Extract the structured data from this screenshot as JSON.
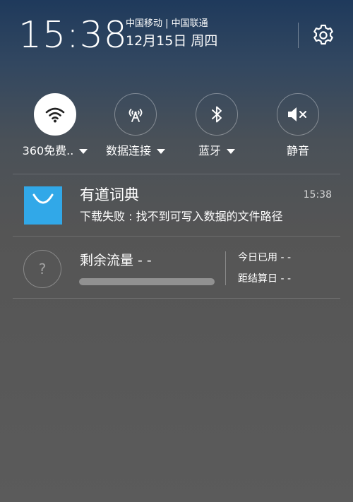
{
  "status": {
    "time": "15:38",
    "carriers": "中国移动 | 中国联通",
    "date": "12月15日 周四"
  },
  "toggles": [
    {
      "label": "360免费..",
      "icon": "wifi-icon",
      "active": true,
      "has_dropdown": true
    },
    {
      "label": "数据连接",
      "icon": "mobile-data-icon",
      "active": false,
      "has_dropdown": true
    },
    {
      "label": "蓝牙",
      "icon": "bluetooth-icon",
      "active": false,
      "has_dropdown": true
    },
    {
      "label": "静音",
      "icon": "mute-icon",
      "active": false,
      "has_dropdown": false
    }
  ],
  "notification": {
    "app": "有道词典",
    "time": "15:38",
    "text": "下载失败 : 找不到可写入数据的文件路径",
    "icon": "youdao-dictionary-icon",
    "icon_color": "#31a8e8"
  },
  "data_usage": {
    "icon_glyph": "?",
    "title": "剩余流量 - -",
    "today_used": "今日已用 - -",
    "days_to_billing": "距结算日 - -"
  }
}
